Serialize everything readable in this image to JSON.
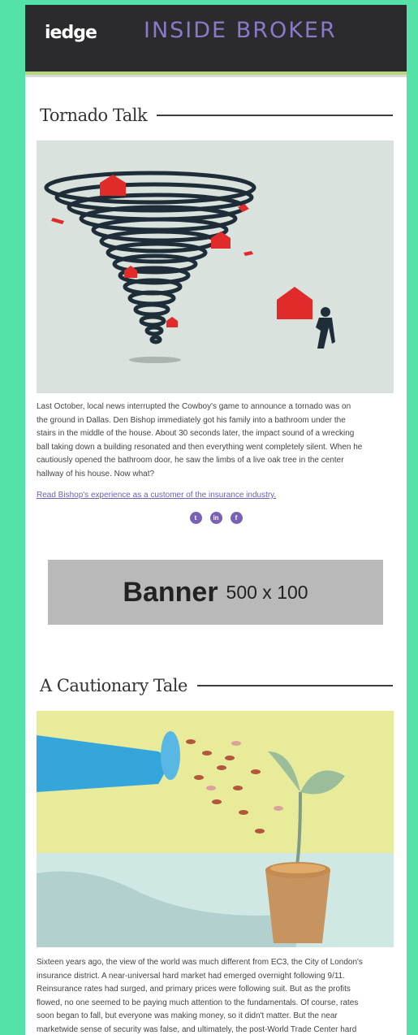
{
  "header": {
    "logo": "iedge",
    "brand": "INSIDE BROKER"
  },
  "article1": {
    "title": "Tornado Talk",
    "image_alt": "tornado-houses-illustration",
    "lines": [
      "Last October, local news interrupted the Cowboy's game to announce a tornado was on",
      "the ground in Dallas. Den Bishop immediately got his family into a bathroom under the",
      "stairs in the middle of the house. About 30 seconds later, the impact sound of a wrecking",
      "ball taking down a building resonated and then everything went completely silent. When he",
      "cautiously opened the bathroom door, he saw the limbs of a live oak tree in the center",
      "hallway of his house. Now what?"
    ],
    "link": "Read Bishop's experience as a customer of the insurance industry."
  },
  "social": [
    {
      "name": "twitter-icon",
      "glyph": "t"
    },
    {
      "name": "linkedin-icon",
      "glyph": "in"
    },
    {
      "name": "facebook-icon",
      "glyph": "f"
    }
  ],
  "banner": {
    "word": "Banner",
    "size": "500 x 100"
  },
  "article2": {
    "title": "A Cautionary Tale",
    "image_alt": "watering-can-money-plant-illustration",
    "lines": [
      "Sixteen years ago, the view of the world was much different from EC3, the City of London's",
      "insurance district. A near-universal hard market had emerged overnight following 9/11.",
      "Reinsurance rates had surged, and primary prices were following suit. But as the profits",
      "flowed, no one seemed to be paying much attention to the fundamentals. Of course, rates",
      "soon began to fall, but everyone was making money, so it didn't matter. But the near",
      "marketwide sense of security was false, and ultimately, the post-World Trade Center hard"
    ]
  },
  "colors": {
    "page_bg": "#55e2a9",
    "header_bg": "#2b2a2d",
    "brand": "#8c79c7",
    "accent_line": "#b8d47c",
    "link": "#6e5fb0"
  }
}
